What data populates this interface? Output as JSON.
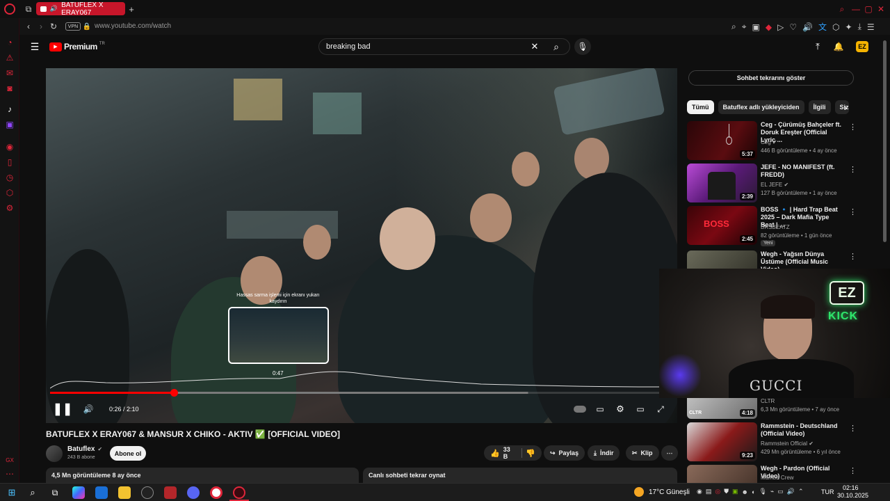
{
  "browser": {
    "tab_title": "BATUFLEX X ERAY067",
    "url": "www.youtube.com/watch",
    "vpn_label": "VPN"
  },
  "yt": {
    "logo_text": "Premium",
    "logo_sup": "TR",
    "search_value": "breaking bad"
  },
  "player": {
    "time": "0:26 / 2:10",
    "hover_time": "0:47",
    "hint": "Hassas sarma işlemi için ekranı yukarı kaydırın",
    "progress_fraction": 0.203
  },
  "video": {
    "title": "BATUFLEX X ERAY067 & MANSUR X CHIKO - AKTIV ✅ [OFFICIAL VIDEO]",
    "channel": "Batuflex",
    "subs": "243 B abone",
    "subscribe": "Abone ol",
    "likes": "33 B",
    "share": "Paylaş",
    "download": "İndir",
    "clip": "Klip",
    "desc_meta": "4,5 Mn görüntüleme  8 ay önce",
    "chat_replay": "Canlı sohbeti tekrar oynat"
  },
  "sidebar": {
    "chat_button": "Sohbet tekrarını göster",
    "chips": [
      "Tümü",
      "Batuflex adlı yükleyiciden",
      "İlgili",
      "Siz"
    ],
    "recs": [
      {
        "title": "Ceg - Çürümüş Bahçeler ft. Doruk Ereşter (Official Lyric ...",
        "channel": "Ceg",
        "meta": "446 B görüntüleme • 4 ay önce",
        "dur": "5:37"
      },
      {
        "title": "JEFE - NO MANIFEST (ft. FREDD)",
        "channel": "EL JEFE",
        "meta": "127 B görüntüleme • 1 ay önce",
        "dur": "2:39"
      },
      {
        "title": "BOSS 🔹 | Hard Trap Beat 2025 – Dark Mafia Type Beat | ...",
        "channel": "BRSBEATZ",
        "meta": "82 görüntüleme • 1 gün önce",
        "dur": "2:45",
        "badge": "Yeni"
      },
      {
        "title": "Wegh - Yağsın Dünya Üstüme (Official Music Video)",
        "channel": "",
        "meta": "",
        "dur": ""
      },
      {
        "title": "",
        "channel": "CLTR",
        "meta": "6,3 Mn görüntüleme • 7 ay önce",
        "dur": "4:18"
      },
      {
        "title": "Rammstein - Deutschland (Official Video)",
        "channel": "Rammstein Official",
        "meta": "429 Mn görüntüleme • 6 yıl önce",
        "dur": "9:23"
      },
      {
        "title": "Wegh - Pardon (Official Video)",
        "channel": "Mamba Crew",
        "meta": "",
        "dur": ""
      }
    ]
  },
  "webcam": {
    "neon_top": "EZ",
    "neon_bottom": "KICK",
    "shirt": "GUCCI"
  },
  "taskbar": {
    "weather": "17°C",
    "weather_label": "Güneşli",
    "lang": "TUR",
    "time": "02:16",
    "date": "30.10.2025"
  },
  "colors": {
    "accent": "#ff0000",
    "opera": "#c7162a",
    "neon": "#2ee66b"
  }
}
